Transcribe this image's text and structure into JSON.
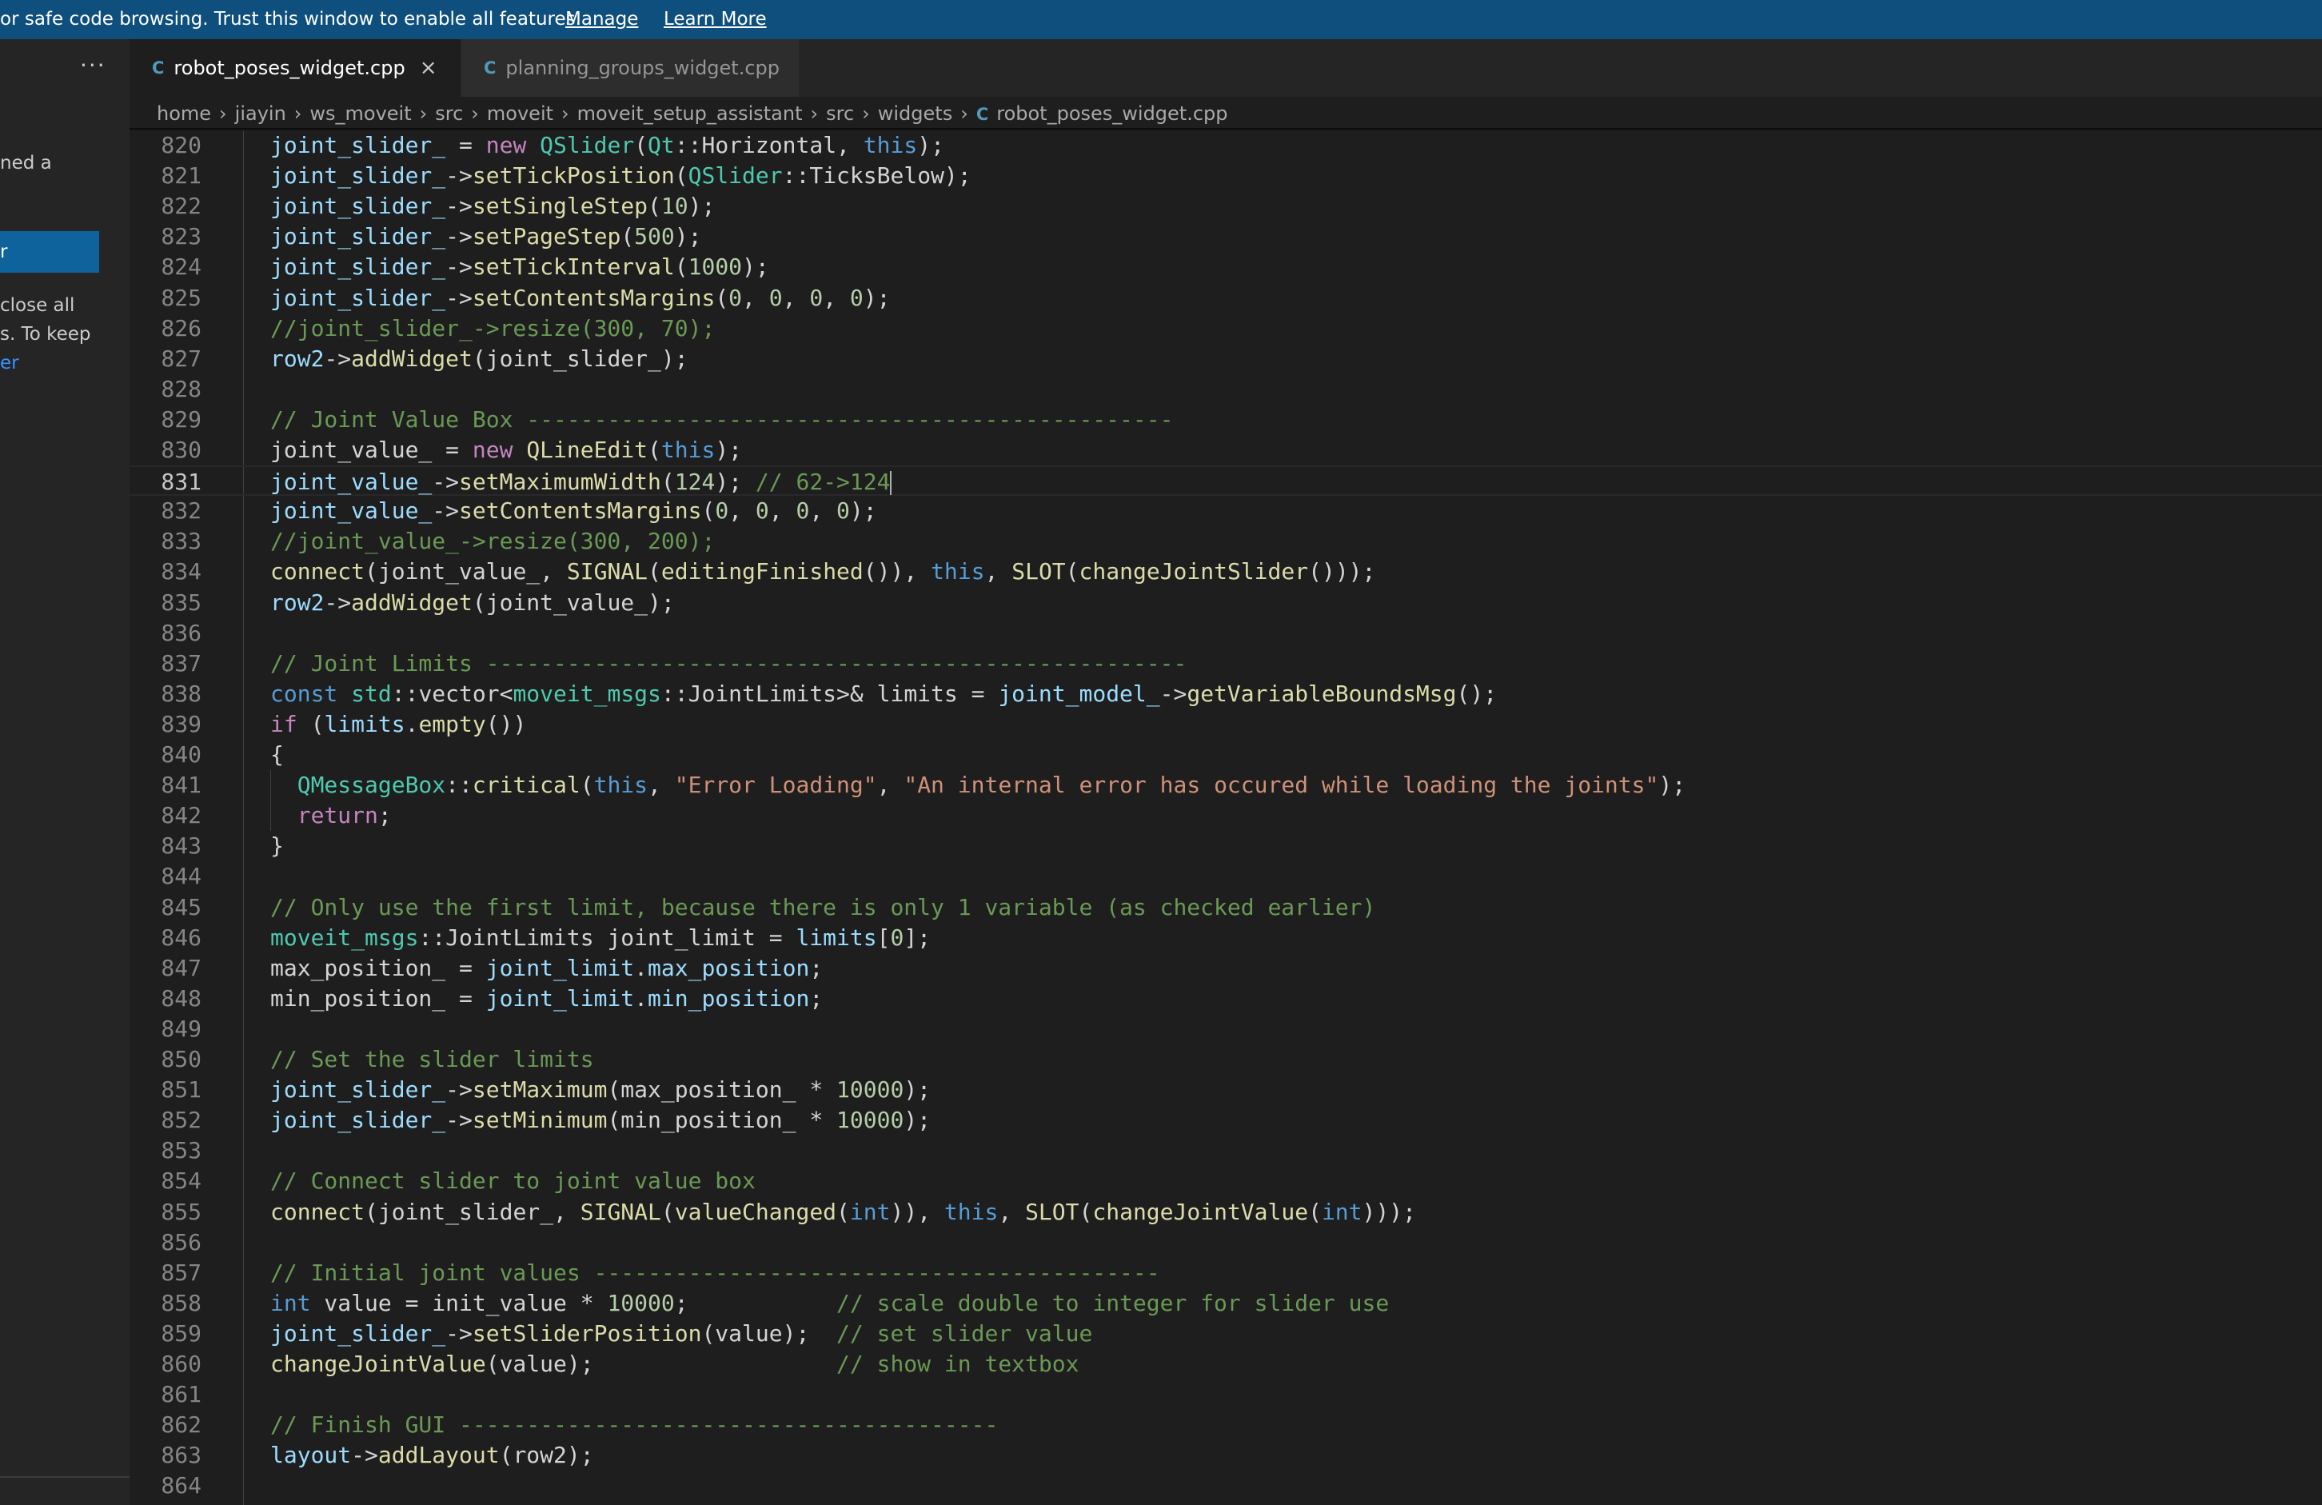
{
  "banner": {
    "message": "or safe code browsing. Trust this window to enable all features.",
    "manage_label": "Manage",
    "learn_more_label": "Learn More"
  },
  "sidebar": {
    "more_label": "···",
    "text_fragment_1": "ned a",
    "button_label": "r",
    "text_fragment_2": "close all",
    "text_fragment_3": "s. To keep",
    "link_fragment": "er"
  },
  "tabs": [
    {
      "label": "robot_poses_widget.cpp",
      "icon": "C",
      "active": true,
      "close": "×"
    },
    {
      "label": "planning_groups_widget.cpp",
      "icon": "C",
      "active": false
    }
  ],
  "breadcrumb": [
    "home",
    "jiayin",
    "ws_moveit",
    "src",
    "moveit",
    "moveit_setup_assistant",
    "src",
    "widgets",
    "robot_poses_widget.cpp"
  ],
  "breadcrumb_separator": "›",
  "editor": {
    "current_line": 831,
    "lines": [
      {
        "n": 820,
        "tokens": [
          [
            "v",
            "joint_slider_"
          ],
          [
            "p",
            " = "
          ],
          [
            "c",
            "new"
          ],
          [
            "p",
            " "
          ],
          [
            "t",
            "QSlider"
          ],
          [
            "p",
            "("
          ],
          [
            "t",
            "Qt"
          ],
          [
            "p",
            "::Horizontal, "
          ],
          [
            "k",
            "this"
          ],
          [
            "p",
            ");"
          ]
        ]
      },
      {
        "n": 821,
        "tokens": [
          [
            "v",
            "joint_slider_"
          ],
          [
            "p",
            "->"
          ],
          [
            "f",
            "setTickPosition"
          ],
          [
            "p",
            "("
          ],
          [
            "t",
            "QSlider"
          ],
          [
            "p",
            "::TicksBelow);"
          ]
        ]
      },
      {
        "n": 822,
        "tokens": [
          [
            "v",
            "joint_slider_"
          ],
          [
            "p",
            "->"
          ],
          [
            "f",
            "setSingleStep"
          ],
          [
            "p",
            "("
          ],
          [
            "n",
            "10"
          ],
          [
            "p",
            ");"
          ]
        ]
      },
      {
        "n": 823,
        "tokens": [
          [
            "v",
            "joint_slider_"
          ],
          [
            "p",
            "->"
          ],
          [
            "f",
            "setPageStep"
          ],
          [
            "p",
            "("
          ],
          [
            "n",
            "500"
          ],
          [
            "p",
            ");"
          ]
        ]
      },
      {
        "n": 824,
        "tokens": [
          [
            "v",
            "joint_slider_"
          ],
          [
            "p",
            "->"
          ],
          [
            "f",
            "setTickInterval"
          ],
          [
            "p",
            "("
          ],
          [
            "n",
            "1000"
          ],
          [
            "p",
            ");"
          ]
        ]
      },
      {
        "n": 825,
        "tokens": [
          [
            "v",
            "joint_slider_"
          ],
          [
            "p",
            "->"
          ],
          [
            "f",
            "setContentsMargins"
          ],
          [
            "p",
            "("
          ],
          [
            "n",
            "0"
          ],
          [
            "p",
            ", "
          ],
          [
            "n",
            "0"
          ],
          [
            "p",
            ", "
          ],
          [
            "n",
            "0"
          ],
          [
            "p",
            ", "
          ],
          [
            "n",
            "0"
          ],
          [
            "p",
            ");"
          ]
        ]
      },
      {
        "n": 826,
        "tokens": [
          [
            "m",
            "//joint_slider_->resize(300, 70);"
          ]
        ]
      },
      {
        "n": 827,
        "tokens": [
          [
            "v",
            "row2"
          ],
          [
            "p",
            "->"
          ],
          [
            "f",
            "addWidget"
          ],
          [
            "p",
            "(joint_slider_);"
          ]
        ]
      },
      {
        "n": 828,
        "tokens": []
      },
      {
        "n": 829,
        "tokens": [
          [
            "m",
            "// Joint Value Box ------------------------------------------------"
          ]
        ]
      },
      {
        "n": 830,
        "tokens": [
          [
            "p",
            "joint_value_ = "
          ],
          [
            "c",
            "new"
          ],
          [
            "p",
            " "
          ],
          [
            "f",
            "QLineEdit"
          ],
          [
            "p",
            "("
          ],
          [
            "k",
            "this"
          ],
          [
            "p",
            ");"
          ]
        ]
      },
      {
        "n": 831,
        "tokens": [
          [
            "v",
            "joint_value_"
          ],
          [
            "p",
            "->"
          ],
          [
            "f",
            "setMaximumWidth"
          ],
          [
            "p",
            "("
          ],
          [
            "n",
            "124"
          ],
          [
            "p",
            "); "
          ],
          [
            "m",
            "// 62->124"
          ]
        ]
      },
      {
        "n": 832,
        "tokens": [
          [
            "v",
            "joint_value_"
          ],
          [
            "p",
            "->"
          ],
          [
            "f",
            "setContentsMargins"
          ],
          [
            "p",
            "("
          ],
          [
            "n",
            "0"
          ],
          [
            "p",
            ", "
          ],
          [
            "n",
            "0"
          ],
          [
            "p",
            ", "
          ],
          [
            "n",
            "0"
          ],
          [
            "p",
            ", "
          ],
          [
            "n",
            "0"
          ],
          [
            "p",
            ");"
          ]
        ]
      },
      {
        "n": 833,
        "tokens": [
          [
            "m",
            "//joint_value_->resize(300, 200);"
          ]
        ]
      },
      {
        "n": 834,
        "tokens": [
          [
            "f",
            "connect"
          ],
          [
            "p",
            "(joint_value_, "
          ],
          [
            "f",
            "SIGNAL"
          ],
          [
            "p",
            "("
          ],
          [
            "f",
            "editingFinished"
          ],
          [
            "p",
            "()), "
          ],
          [
            "k",
            "this"
          ],
          [
            "p",
            ", "
          ],
          [
            "f",
            "SLOT"
          ],
          [
            "p",
            "("
          ],
          [
            "f",
            "changeJointSlider"
          ],
          [
            "p",
            "()));"
          ]
        ]
      },
      {
        "n": 835,
        "tokens": [
          [
            "v",
            "row2"
          ],
          [
            "p",
            "->"
          ],
          [
            "f",
            "addWidget"
          ],
          [
            "p",
            "(joint_value_);"
          ]
        ]
      },
      {
        "n": 836,
        "tokens": []
      },
      {
        "n": 837,
        "tokens": [
          [
            "m",
            "// Joint Limits ----------------------------------------------------"
          ]
        ]
      },
      {
        "n": 838,
        "tokens": [
          [
            "k",
            "const"
          ],
          [
            "p",
            " "
          ],
          [
            "t",
            "std"
          ],
          [
            "p",
            "::vector<"
          ],
          [
            "t",
            "moveit_msgs"
          ],
          [
            "p",
            "::JointLimits>& limits = "
          ],
          [
            "v",
            "joint_model_"
          ],
          [
            "p",
            "->"
          ],
          [
            "f",
            "getVariableBoundsMsg"
          ],
          [
            "p",
            "();"
          ]
        ]
      },
      {
        "n": 839,
        "tokens": [
          [
            "c",
            "if"
          ],
          [
            "p",
            " ("
          ],
          [
            "v",
            "limits"
          ],
          [
            "p",
            "."
          ],
          [
            "f",
            "empty"
          ],
          [
            "p",
            "())"
          ]
        ]
      },
      {
        "n": 840,
        "tokens": [
          [
            "p",
            "{"
          ]
        ]
      },
      {
        "n": 841,
        "tokens": [
          [
            "p",
            "  "
          ],
          [
            "t",
            "QMessageBox"
          ],
          [
            "p",
            "::"
          ],
          [
            "f",
            "critical"
          ],
          [
            "p",
            "("
          ],
          [
            "k",
            "this"
          ],
          [
            "p",
            ", "
          ],
          [
            "s",
            "\"Error Loading\""
          ],
          [
            "p",
            ", "
          ],
          [
            "s",
            "\"An internal error has occured while loading the joints\""
          ],
          [
            "p",
            ");"
          ]
        ]
      },
      {
        "n": 842,
        "tokens": [
          [
            "p",
            "  "
          ],
          [
            "c",
            "return"
          ],
          [
            "p",
            ";"
          ]
        ]
      },
      {
        "n": 843,
        "tokens": [
          [
            "p",
            "}"
          ]
        ]
      },
      {
        "n": 844,
        "tokens": []
      },
      {
        "n": 845,
        "tokens": [
          [
            "m",
            "// Only use the first limit, because there is only 1 variable (as checked earlier)"
          ]
        ]
      },
      {
        "n": 846,
        "tokens": [
          [
            "t",
            "moveit_msgs"
          ],
          [
            "p",
            "::JointLimits joint_limit = "
          ],
          [
            "v",
            "limits"
          ],
          [
            "p",
            "["
          ],
          [
            "n",
            "0"
          ],
          [
            "p",
            "];"
          ]
        ]
      },
      {
        "n": 847,
        "tokens": [
          [
            "p",
            "max_position_ = "
          ],
          [
            "v",
            "joint_limit"
          ],
          [
            "p",
            "."
          ],
          [
            "v",
            "max_position"
          ],
          [
            "p",
            ";"
          ]
        ]
      },
      {
        "n": 848,
        "tokens": [
          [
            "p",
            "min_position_ = "
          ],
          [
            "v",
            "joint_limit"
          ],
          [
            "p",
            "."
          ],
          [
            "v",
            "min_position"
          ],
          [
            "p",
            ";"
          ]
        ]
      },
      {
        "n": 849,
        "tokens": []
      },
      {
        "n": 850,
        "tokens": [
          [
            "m",
            "// Set the slider limits"
          ]
        ]
      },
      {
        "n": 851,
        "tokens": [
          [
            "v",
            "joint_slider_"
          ],
          [
            "p",
            "->"
          ],
          [
            "f",
            "setMaximum"
          ],
          [
            "p",
            "(max_position_ * "
          ],
          [
            "n",
            "10000"
          ],
          [
            "p",
            ");"
          ]
        ]
      },
      {
        "n": 852,
        "tokens": [
          [
            "v",
            "joint_slider_"
          ],
          [
            "p",
            "->"
          ],
          [
            "f",
            "setMinimum"
          ],
          [
            "p",
            "(min_position_ * "
          ],
          [
            "n",
            "10000"
          ],
          [
            "p",
            ");"
          ]
        ]
      },
      {
        "n": 853,
        "tokens": []
      },
      {
        "n": 854,
        "tokens": [
          [
            "m",
            "// Connect slider to joint value box"
          ]
        ]
      },
      {
        "n": 855,
        "tokens": [
          [
            "f",
            "connect"
          ],
          [
            "p",
            "(joint_slider_, "
          ],
          [
            "f",
            "SIGNAL"
          ],
          [
            "p",
            "("
          ],
          [
            "f",
            "valueChanged"
          ],
          [
            "p",
            "("
          ],
          [
            "k",
            "int"
          ],
          [
            "p",
            ")), "
          ],
          [
            "k",
            "this"
          ],
          [
            "p",
            ", "
          ],
          [
            "f",
            "SLOT"
          ],
          [
            "p",
            "("
          ],
          [
            "f",
            "changeJointValue"
          ],
          [
            "p",
            "("
          ],
          [
            "k",
            "int"
          ],
          [
            "p",
            ")));"
          ]
        ]
      },
      {
        "n": 856,
        "tokens": []
      },
      {
        "n": 857,
        "tokens": [
          [
            "m",
            "// Initial joint values ------------------------------------------"
          ]
        ]
      },
      {
        "n": 858,
        "tokens": [
          [
            "k",
            "int"
          ],
          [
            "p",
            " value = init_value * "
          ],
          [
            "n",
            "10000"
          ],
          [
            "p",
            ";           "
          ],
          [
            "m",
            "// scale double to integer for slider use"
          ]
        ]
      },
      {
        "n": 859,
        "tokens": [
          [
            "v",
            "joint_slider_"
          ],
          [
            "p",
            "->"
          ],
          [
            "f",
            "setSliderPosition"
          ],
          [
            "p",
            "(value);  "
          ],
          [
            "m",
            "// set slider value"
          ]
        ]
      },
      {
        "n": 860,
        "tokens": [
          [
            "f",
            "changeJointValue"
          ],
          [
            "p",
            "(value);                  "
          ],
          [
            "m",
            "// show in textbox"
          ]
        ]
      },
      {
        "n": 861,
        "tokens": []
      },
      {
        "n": 862,
        "tokens": [
          [
            "m",
            "// Finish GUI ----------------------------------------"
          ]
        ]
      },
      {
        "n": 863,
        "tokens": [
          [
            "v",
            "layout"
          ],
          [
            "p",
            "->"
          ],
          [
            "f",
            "addLayout"
          ],
          [
            "p",
            "(row2);"
          ]
        ]
      },
      {
        "n": 864,
        "tokens": []
      }
    ]
  },
  "colors": {
    "banner": "#0e4f7e",
    "editor_bg": "#1e1e1e",
    "keyword": "#569cd6",
    "control": "#c586c0",
    "type": "#4ec9b0",
    "function": "#dcdcaa",
    "variable": "#9cdcfe",
    "number": "#b5cea8",
    "string": "#ce9178",
    "comment": "#6a9955"
  }
}
